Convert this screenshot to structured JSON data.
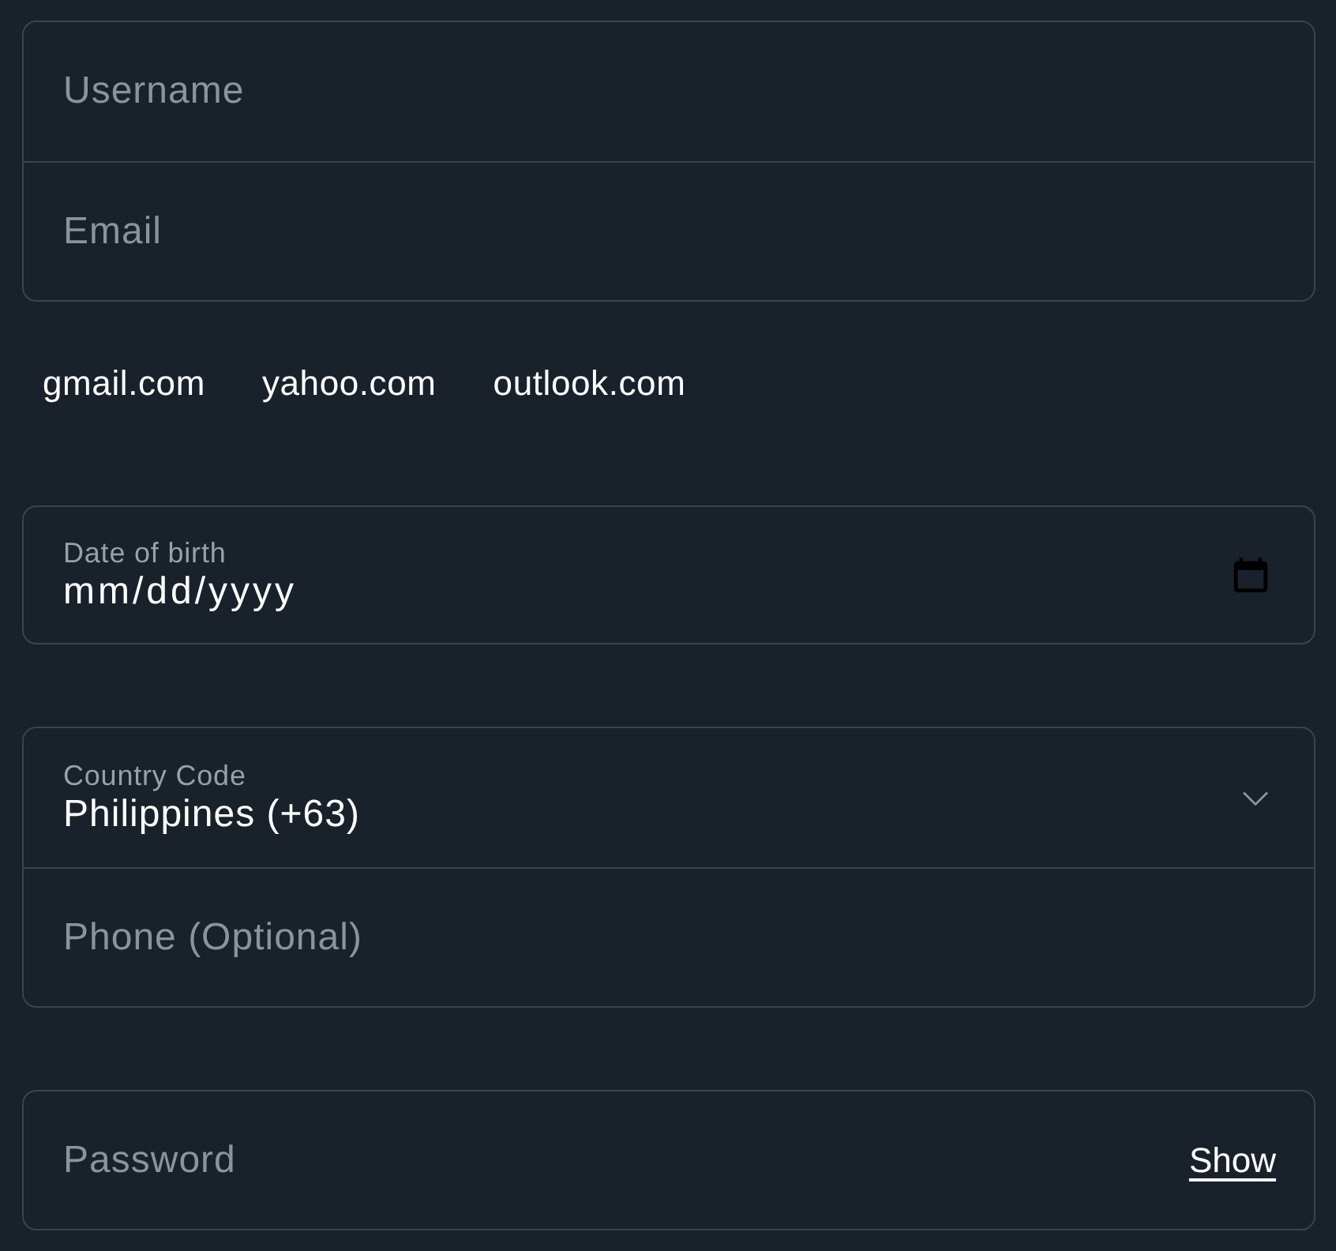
{
  "account_fields": [
    {
      "placeholder": "Username"
    },
    {
      "placeholder": "Email"
    }
  ],
  "email_suggestions": [
    "gmail.com",
    "yahoo.com",
    "outlook.com"
  ],
  "date_of_birth": {
    "label": "Date of birth",
    "value": "mm/dd/yyyy"
  },
  "phone_group": {
    "country_code": {
      "label": "Country Code",
      "value": "Philippines (+63)"
    },
    "phone": {
      "placeholder": "Phone (Optional)"
    }
  },
  "password": {
    "placeholder": "Password",
    "toggle": "Show"
  }
}
